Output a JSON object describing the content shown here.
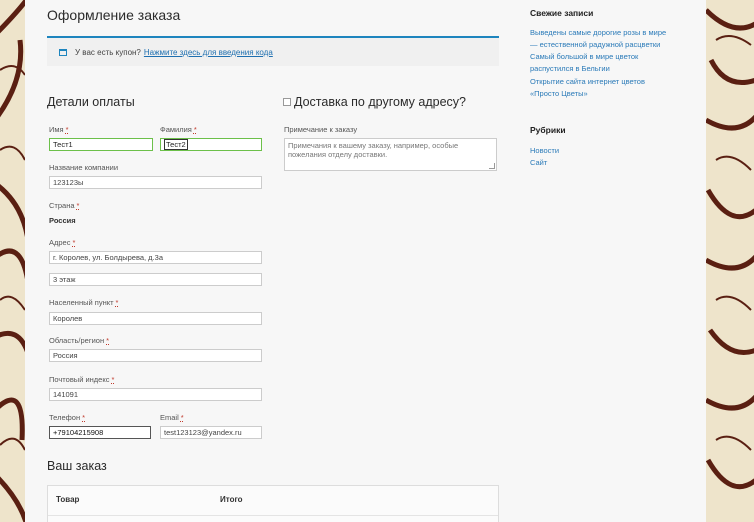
{
  "page_title": "Оформление заказа",
  "coupon": {
    "text": "У вас есть купон?",
    "link": "Нажмите здесь для введения кода"
  },
  "billing": {
    "title": "Детали оплаты",
    "required_mark": "*",
    "first_name": {
      "label": "Имя",
      "value": "Тест1"
    },
    "last_name": {
      "label": "Фамилия",
      "value": "Тест2"
    },
    "company": {
      "label": "Название компании",
      "value": "123123ы"
    },
    "country": {
      "label": "Страна",
      "value": "Россия"
    },
    "address": {
      "label": "Адрес",
      "line1": "г. Королев, ул. Болдырева, д.3а",
      "line2": "3 этаж"
    },
    "city": {
      "label": "Населенный пункт",
      "value": "Королев"
    },
    "region": {
      "label": "Область/регион",
      "value": "Россия"
    },
    "postcode": {
      "label": "Почтовый индекс",
      "value": "141091"
    },
    "phone": {
      "label": "Телефон",
      "value": "+79104215908"
    },
    "email": {
      "label": "Email",
      "value": "test123123@yandex.ru"
    }
  },
  "shipping": {
    "title": "Доставка по другому адресу?",
    "checked": false
  },
  "notes": {
    "label": "Примечание к заказу",
    "placeholder": "Примечания к вашему заказу, например, особые пожелания отделу доставки."
  },
  "order": {
    "title": "Ваш заказ",
    "col_product": "Товар",
    "col_total": "Итого"
  },
  "sidebar": {
    "recent_title": "Свежие записи",
    "recent_posts": [
      "Выведены самые дорогие розы в мире",
      "— естественной радужной расцветки",
      "Самый большой в мире цветок",
      "распустился в Бельгии",
      "Открытие сайта интернет цветов",
      "«Просто Цветы»"
    ],
    "categories_title": "Рубрики",
    "categories": [
      "Новости",
      "Сайт"
    ]
  },
  "colors": {
    "accent": "#1e85be",
    "link": "#2a7ab8",
    "required": "#c0392b",
    "valid_border": "#6cc04a",
    "background_pattern": "#5a1f12"
  }
}
